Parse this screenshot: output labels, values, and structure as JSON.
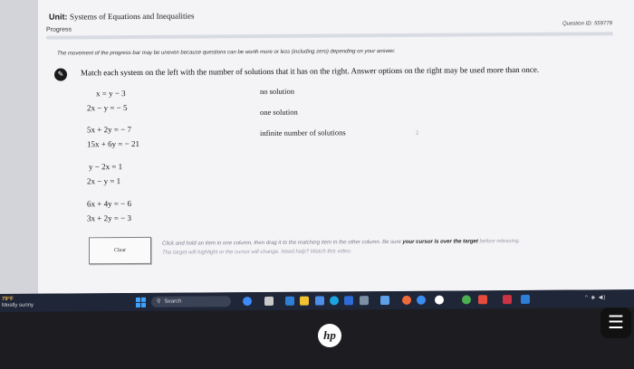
{
  "header": {
    "unit_label": "Unit:",
    "unit_title": "Systems of Equations and Inequalities",
    "progress_label": "Progress",
    "progress_fraction": 0.0,
    "question_id": "Question ID: 559779",
    "progress_note": "The movement of the progress bar may be uneven because questions can be worth more or less (including zero) depending on your answer."
  },
  "question": {
    "instruction": "Match each system on the left with the number of solutions that it has on the right. Answer options on the right may be used more than once.",
    "systems": [
      {
        "eq1": "x = y − 3",
        "eq2": "2x − y = − 5"
      },
      {
        "eq1": "5x + 2y = − 7",
        "eq2": "15x + 6y = − 21"
      },
      {
        "eq1": "y − 2x = 1",
        "eq2": "2x − y = 1"
      },
      {
        "eq1": "6x + 4y = − 6",
        "eq2": "3x + 2y = − 3"
      }
    ],
    "answers": [
      "no solution",
      "one solution",
      "infinite number of solutions"
    ],
    "stray_mark": "2"
  },
  "controls": {
    "clear_label": "Clear",
    "hint_line1": "Click and hold an item in one column, then drag it to the matching item in the other column. Be sure",
    "hint_bold": "your cursor is over the target",
    "hint_line1_end": "before releasing.",
    "hint_line2": "The target will highlight or the cursor will change. Need help? Watch this video."
  },
  "taskbar": {
    "weather_temp": "79°F",
    "weather_desc": "Mostly sunny",
    "search_label": "Search",
    "search_icon": "magnifier-icon",
    "colors": {
      "taskbar": "#1f2638",
      "windows_logo": "#3ca2ff"
    }
  },
  "laptop": {
    "brand": "hp"
  }
}
